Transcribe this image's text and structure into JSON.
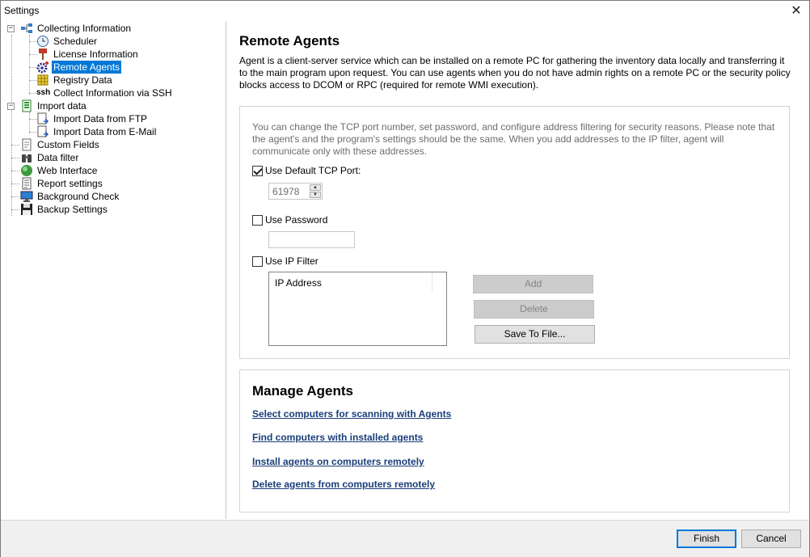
{
  "window": {
    "title": "Settings",
    "close_glyph": "✕"
  },
  "tree": {
    "items": [
      {
        "label": "Collecting Information",
        "icon": "network-icon"
      },
      {
        "label": "Scheduler",
        "icon": "clock-icon"
      },
      {
        "label": "License Information",
        "icon": "license-icon"
      },
      {
        "label": "Remote Agents",
        "icon": "agent-gear-icon"
      },
      {
        "label": "Registry Data",
        "icon": "grid-icon"
      },
      {
        "label": "Collect Information via SSH",
        "icon": "ssh-icon"
      },
      {
        "label": "Import data",
        "icon": "import-icon"
      },
      {
        "label": "Import Data from FTP",
        "icon": "ftp-icon"
      },
      {
        "label": "Import Data from E-Mail",
        "icon": "email-icon"
      },
      {
        "label": "Custom Fields",
        "icon": "fields-icon"
      },
      {
        "label": "Data filter",
        "icon": "binoculars-icon"
      },
      {
        "label": "Web Interface",
        "icon": "globe-icon"
      },
      {
        "label": "Report settings",
        "icon": "report-icon"
      },
      {
        "label": "Background Check",
        "icon": "monitor-icon"
      },
      {
        "label": "Backup Settings",
        "icon": "floppy-icon"
      }
    ],
    "ssh_text": "ssh",
    "collapse_glyph": "−"
  },
  "remote": {
    "title": "Remote Agents",
    "description": "Agent is a client-server service which can be installed on a remote PC for gathering the inventory data locally and transferring it to the main program upon request. You can use agents when you do not have admin rights on a remote PC or the security policy blocks access to DCOM or RPC (required for remote WMI execution).",
    "note": "You can change the TCP port number, set password, and configure address filtering for security reasons. Please note that the agent's and the program's settings should be the same. When you add addresses to the IP filter, agent will communicate only with these addresses.",
    "use_default_port_label": "Use Default TCP Port:",
    "port_value": "61978",
    "use_password_label": "Use Password",
    "use_ip_filter_label": "Use IP Filter",
    "ip_column": "IP Address",
    "add_label": "Add",
    "delete_label": "Delete",
    "save_label": "Save To File..."
  },
  "manage": {
    "title": "Manage Agents",
    "links": [
      "Select computers for scanning with Agents",
      "Find computers with installed agents",
      "Install agents on computers remotely",
      "Delete agents from computers remotely"
    ]
  },
  "footer": {
    "finish_label": "Finish",
    "cancel_label": "Cancel"
  },
  "colors": {
    "selection": "#0078d7",
    "link": "#1a3e7a"
  }
}
